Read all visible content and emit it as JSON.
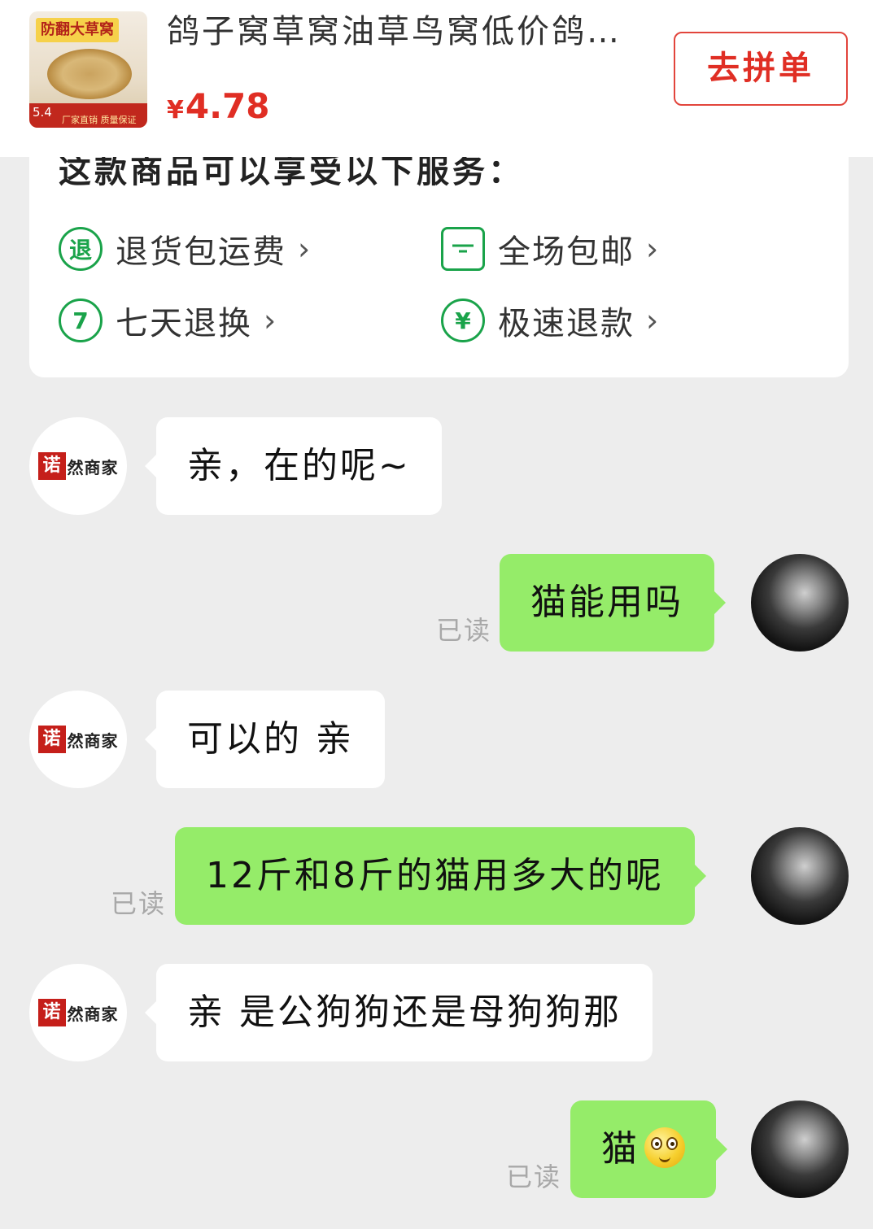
{
  "product": {
    "thumbnail_banner": "防翻大草窝",
    "thumbnail_number": "5.4",
    "thumbnail_footer": "厂家直销 质量保证",
    "title": "鸽子窝草窝油草鸟窝低价鸽…",
    "price_symbol": "¥",
    "price": "4.78",
    "action_button": "去拼单"
  },
  "services": {
    "heading": "这款商品可以享受以下服务：",
    "items": [
      {
        "icon": "return-icon",
        "icon_glyph": "退",
        "label": "退货包运费"
      },
      {
        "icon": "box-icon",
        "icon_glyph": "",
        "label": "全场包邮"
      },
      {
        "icon": "seven-day-icon",
        "icon_glyph": "7",
        "label": "七天退换"
      },
      {
        "icon": "refund-icon",
        "icon_glyph": "¥",
        "label": "极速退款"
      }
    ],
    "chevron": "›"
  },
  "shop": {
    "logo_seal": "诺",
    "logo_name": "然商家"
  },
  "messages": [
    {
      "side": "left",
      "text": "亲，在的呢~"
    },
    {
      "side": "right",
      "text": "猫能用吗",
      "status": "已读"
    },
    {
      "side": "left",
      "text": "可以的 亲"
    },
    {
      "side": "right",
      "text": "12斤和8斤的猫用多大的呢",
      "status": "已读"
    },
    {
      "side": "left",
      "text": "亲 是公狗狗还是母狗狗那"
    },
    {
      "side": "right",
      "text": "猫",
      "emoji": "smiley-emoji-icon",
      "status": "已读"
    }
  ],
  "colors": {
    "background": "#ededed",
    "brand_red": "#e02e24",
    "service_green": "#1aa34a",
    "outgoing_bubble": "#95ec69",
    "incoming_bubble": "#ffffff"
  }
}
